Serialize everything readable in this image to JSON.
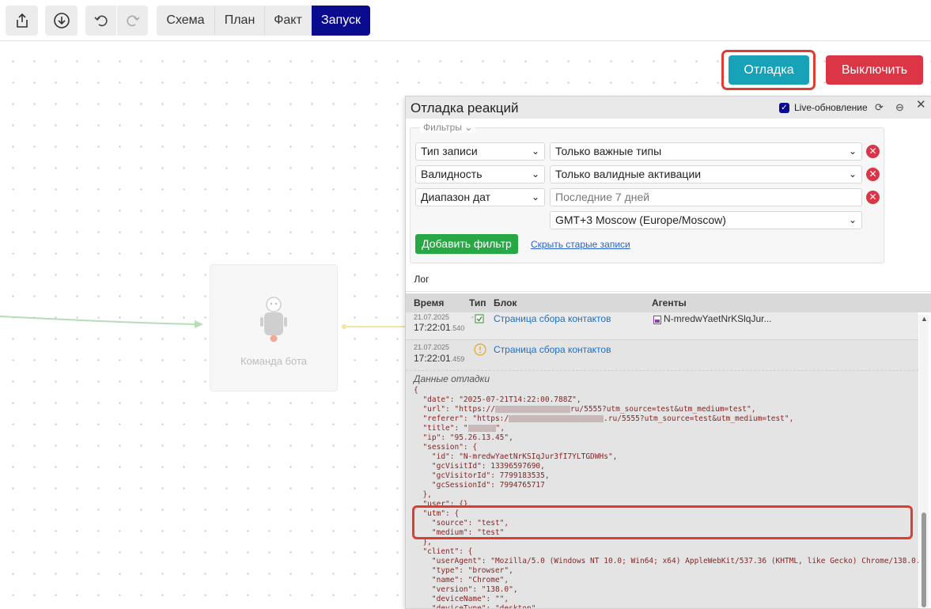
{
  "toolbar": {
    "tabs": [
      "Схема",
      "План",
      "Факт",
      "Запуск"
    ],
    "active_tab": "Запуск"
  },
  "node": {
    "label": "Команда бота"
  },
  "actions": {
    "debug_label": "Отладка",
    "off_label": "Выключить"
  },
  "panel": {
    "title": "Отладка реакций",
    "live_label": "Live-обновление",
    "filters_legend": "Фильтры",
    "filters": [
      {
        "field": "Тип записи",
        "value": "Только важные типы"
      },
      {
        "field": "Валидность",
        "value": "Только валидные активации"
      },
      {
        "field": "Диапазон дат",
        "value": "Последние 7 дней"
      }
    ],
    "timezone": "GMT+3 Moscow (Europe/Moscow)",
    "add_filter": "Добавить фильтр",
    "hide_old": "Скрыть старые записи",
    "log_tab": "Лог",
    "columns": [
      "Время",
      "Тип",
      "Блок",
      "Агенты"
    ],
    "rows": [
      {
        "date": "21.07.2025",
        "time": "17:22:01",
        "ms": ".540",
        "block": "Страница сбора контактов",
        "agent": "N-mredwYaetNrKSlqJur..."
      },
      {
        "date": "21.07.2025",
        "time": "17:22:01",
        "ms": ".459",
        "block": "Страница сбора контактов",
        "agent": ""
      }
    ],
    "debug_data_label": "Данные отладки"
  },
  "colors": {
    "accent": "#0b0b8f",
    "debug_button": "#17a2b8",
    "off_button": "#dc3545",
    "add_filter": "#28a745",
    "highlight": "#e03c31"
  }
}
